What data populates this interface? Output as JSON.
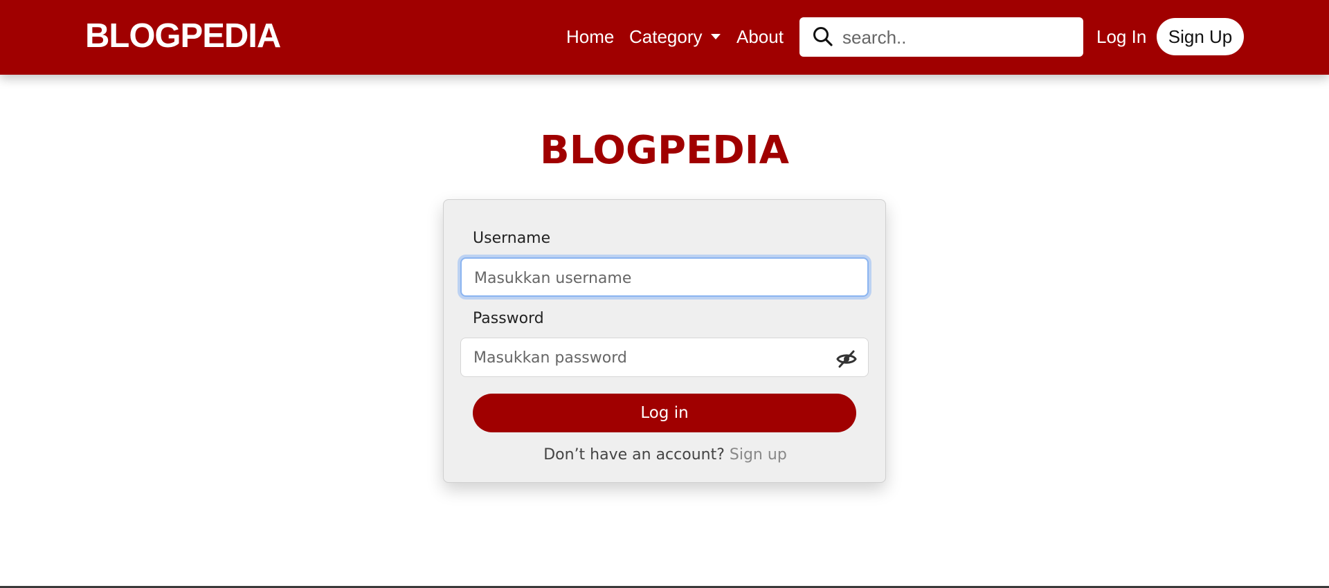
{
  "navbar": {
    "brand": "BLOGPEDIA",
    "links": [
      {
        "label": "Home"
      },
      {
        "label": "Category"
      },
      {
        "label": "About"
      }
    ],
    "search_placeholder": "search..",
    "search_icon": "search-icon",
    "login_label": "Log In",
    "signup_label": "Sign Up",
    "color": "#a00000"
  },
  "login": {
    "title": "BLOGPEDIA",
    "username_label": "Username",
    "username_placeholder": "Masukkan username",
    "password_label": "Password",
    "password_placeholder": "Masukkan password",
    "password_toggle_icon": "eye-slash-icon",
    "submit_label": "Log in",
    "footer_prompt": "Don’t have an account?",
    "footer_link": "Sign up"
  }
}
